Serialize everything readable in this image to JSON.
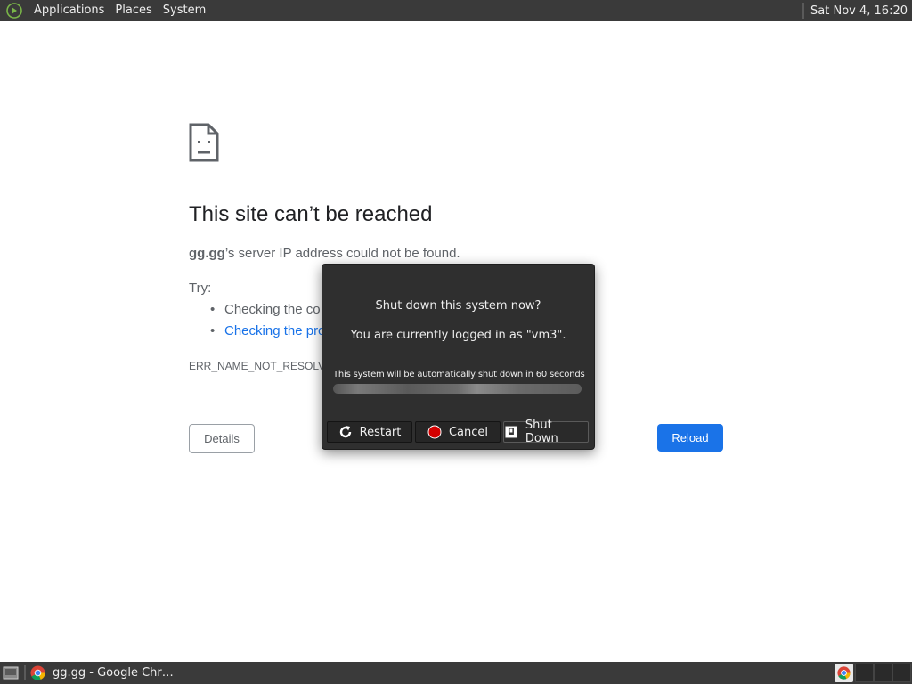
{
  "top_panel": {
    "menus": [
      "Applications",
      "Places",
      "System"
    ],
    "clock": "Sat Nov  4, 16:20"
  },
  "error_page": {
    "title": "This site can’t be reached",
    "host": "gg.gg",
    "host_message": "’s server IP address could not be found.",
    "try_label": "Try:",
    "suggestions": [
      {
        "text": "Checking the co",
        "is_link": false
      },
      {
        "text": "Checking the pro",
        "is_link": true
      }
    ],
    "error_code": "ERR_NAME_NOT_RESOLV",
    "details_label": "Details",
    "reload_label": "Reload",
    "colors": {
      "reload_bg": "#1a73e8",
      "link": "#1a73e8",
      "text": "#5f6368"
    }
  },
  "dialog": {
    "heading": "Shut down this system now?",
    "logged_in_text": "You are currently logged in as \"vm3\".",
    "countdown_text": "This system will be automatically shut down in 60 seconds",
    "progress_fraction": 0.0,
    "buttons": [
      {
        "label": "Restart",
        "icon": "restart-icon"
      },
      {
        "label": "Cancel",
        "icon": "cancel-icon"
      },
      {
        "label": "Shut Down",
        "icon": "shutdown-icon"
      }
    ]
  },
  "taskbar": {
    "task_title": "gg.gg - Google Chr…",
    "task_icon": "chrome-icon"
  }
}
